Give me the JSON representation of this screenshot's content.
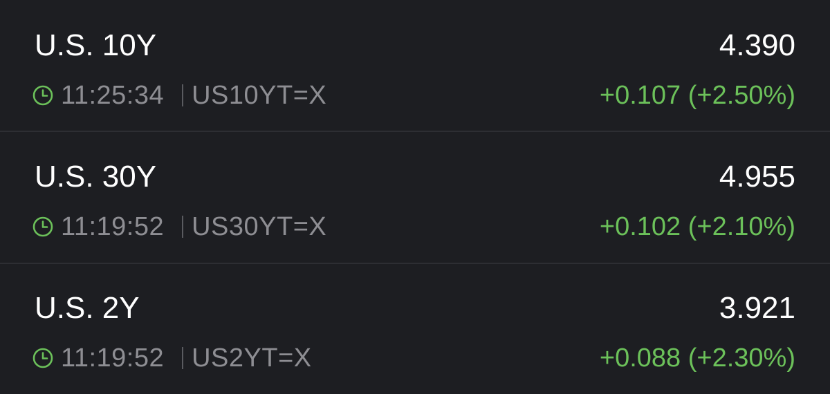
{
  "colors": {
    "background": "#1d1e22",
    "divider": "#2d2e33",
    "primary_text": "#ffffff",
    "secondary_text": "#8e8e93",
    "positive": "#6cc15a"
  },
  "quotes": [
    {
      "name": "U.S. 10Y",
      "price": "4.390",
      "time": "11:25:34",
      "separator": "|",
      "symbol": "US10YT=X",
      "change": "+0.107 (+2.50%)",
      "icon": "clock-icon"
    },
    {
      "name": "U.S. 30Y",
      "price": "4.955",
      "time": "11:19:52",
      "separator": "|",
      "symbol": "US30YT=X",
      "change": "+0.102 (+2.10%)",
      "icon": "clock-icon"
    },
    {
      "name": "U.S. 2Y",
      "price": "3.921",
      "time": "11:19:52",
      "separator": "|",
      "symbol": "US2YT=X",
      "change": "+0.088 (+2.30%)",
      "icon": "clock-icon"
    }
  ]
}
